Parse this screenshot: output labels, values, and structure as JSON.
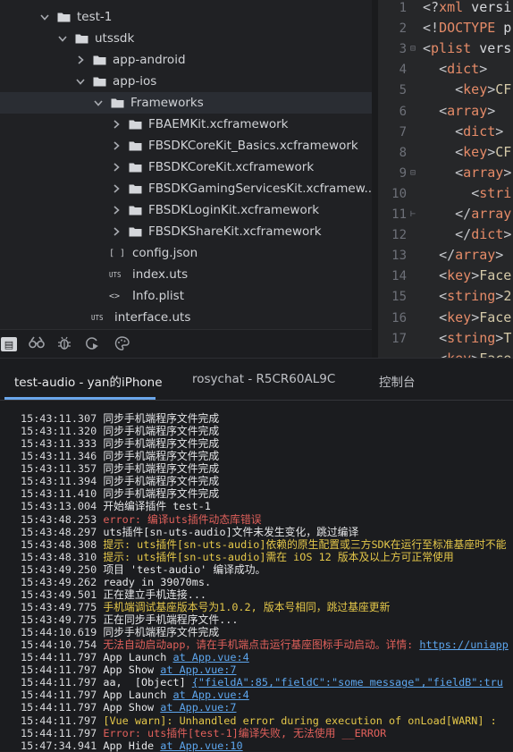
{
  "tree": {
    "items": [
      {
        "label": "test-1",
        "kind": "folder",
        "expanded": true
      },
      {
        "label": "utssdk",
        "kind": "folder",
        "expanded": true
      },
      {
        "label": "app-android",
        "kind": "folder",
        "expanded": false
      },
      {
        "label": "app-ios",
        "kind": "folder",
        "expanded": true
      },
      {
        "label": "Frameworks",
        "kind": "folder",
        "expanded": true
      },
      {
        "label": "FBAEMKit.xcframework",
        "kind": "folder",
        "expanded": false
      },
      {
        "label": "FBSDKCoreKit_Basics.xcframework",
        "kind": "folder",
        "expanded": false
      },
      {
        "label": "FBSDKCoreKit.xcframework",
        "kind": "folder",
        "expanded": false
      },
      {
        "label": "FBSDKGamingServicesKit.xcframew...",
        "kind": "folder",
        "expanded": false
      },
      {
        "label": "FBSDKLoginKit.xcframework",
        "kind": "folder",
        "expanded": false
      },
      {
        "label": "FBSDKShareKit.xcframework",
        "kind": "folder",
        "expanded": false
      },
      {
        "label": "config.json",
        "kind": "file",
        "icon": "[ ]"
      },
      {
        "label": "index.uts",
        "kind": "file",
        "icon": "UTS"
      },
      {
        "label": "Info.plist",
        "kind": "file",
        "icon": "<>"
      },
      {
        "label": "interface.uts",
        "kind": "file",
        "icon": "UTS"
      }
    ],
    "toolbar_icons": [
      "explorer-icon",
      "binoculars-icon",
      "bug-icon",
      "run-icon",
      "palette-icon"
    ]
  },
  "editor": {
    "line_numbers": [
      "1",
      "2",
      "3",
      "4",
      "5",
      "6",
      "7",
      "8",
      "9",
      "10",
      "11",
      "12",
      "13",
      "14",
      "15",
      "16",
      "17"
    ],
    "lines": [
      {
        "t": "<?xml versi"
      },
      {
        "t": "<!DOCTYPE p"
      },
      {
        "t": "<plist vers"
      },
      {
        "t": "  <dict>"
      },
      {
        "t": "    <key>CF"
      },
      {
        "t": "  <array>"
      },
      {
        "t": "    <dict>"
      },
      {
        "t": "    <key>CF"
      },
      {
        "t": "    <array>"
      },
      {
        "t": "      <stri"
      },
      {
        "t": "    </array"
      },
      {
        "t": "    </dict>"
      },
      {
        "t": "  </array>"
      },
      {
        "t": "  <key>Face"
      },
      {
        "t": "  <string>2"
      },
      {
        "t": "  <key>Face"
      },
      {
        "t": "  <string>T"
      },
      {
        "t": "  <key>Face"
      }
    ]
  },
  "console": {
    "tabs": [
      {
        "label": "test-audio - yan的iPhone",
        "active": true
      },
      {
        "label": "rosychat - R5CR60AL9C",
        "active": false
      },
      {
        "label": "控制台",
        "active": false
      }
    ],
    "log": [
      {
        "ts": "15:43:11.307",
        "parts": [
          {
            "text": "同步手机端程序文件完成",
            "style": "msg"
          }
        ]
      },
      {
        "ts": "15:43:11.320",
        "parts": [
          {
            "text": "同步手机端程序文件完成",
            "style": "msg"
          }
        ]
      },
      {
        "ts": "15:43:11.333",
        "parts": [
          {
            "text": "同步手机端程序文件完成",
            "style": "msg"
          }
        ]
      },
      {
        "ts": "15:43:11.346",
        "parts": [
          {
            "text": "同步手机端程序文件完成",
            "style": "msg"
          }
        ]
      },
      {
        "ts": "15:43:11.357",
        "parts": [
          {
            "text": "同步手机端程序文件完成",
            "style": "msg"
          }
        ]
      },
      {
        "ts": "15:43:11.394",
        "parts": [
          {
            "text": "同步手机端程序文件完成",
            "style": "msg"
          }
        ]
      },
      {
        "ts": "15:43:11.410",
        "parts": [
          {
            "text": "同步手机端程序文件完成",
            "style": "msg"
          }
        ]
      },
      {
        "ts": "15:43:13.004",
        "parts": [
          {
            "text": "开始编译插件 test-1",
            "style": "msg"
          }
        ]
      },
      {
        "ts": "15:43:48.253",
        "parts": [
          {
            "text": "error: 编译uts插件动态库错误",
            "style": "error"
          }
        ]
      },
      {
        "ts": "15:43:48.297",
        "parts": [
          {
            "text": "uts插件[sn-uts-audio]文件未发生变化，跳过编译",
            "style": "msg"
          }
        ]
      },
      {
        "ts": "15:43:48.308",
        "parts": [
          {
            "text": "提示: uts插件[sn-uts-audio]依赖的原生配置或三方SDK在运行至标准基座时不能",
            "style": "warn"
          }
        ]
      },
      {
        "ts": "15:43:48.310",
        "parts": [
          {
            "text": "提示: uts插件[sn-uts-audio]需在 iOS 12 版本及以上方可正常使用",
            "style": "warn"
          }
        ]
      },
      {
        "ts": "15:43:49.250",
        "parts": [
          {
            "text": "项目 'test-audio' 编译成功。",
            "style": "msg"
          }
        ]
      },
      {
        "ts": "15:43:49.262",
        "parts": [
          {
            "text": "ready in 39070ms.",
            "style": "msg"
          }
        ]
      },
      {
        "ts": "15:43:49.501",
        "parts": [
          {
            "text": "正在建立手机连接...",
            "style": "msg"
          }
        ]
      },
      {
        "ts": "15:43:49.775",
        "parts": [
          {
            "text": "手机端调试基座版本号为1.0.2, 版本号相同，跳过基座更新",
            "style": "warn"
          }
        ]
      },
      {
        "ts": "15:43:49.775",
        "parts": [
          {
            "text": "正在同步手机端程序文件...",
            "style": "msg"
          }
        ]
      },
      {
        "ts": "15:44:10.619",
        "parts": [
          {
            "text": "同步手机端程序文件完成",
            "style": "msg"
          }
        ]
      },
      {
        "ts": "15:44:10.754",
        "parts": [
          {
            "text": "无法自动启动app，请在手机端点击运行基座图标手动启动。详情: ",
            "style": "error"
          },
          {
            "text": "https://uniapp",
            "style": "link"
          }
        ]
      },
      {
        "ts": "15:44:11.797",
        "parts": [
          {
            "text": "App Launch ",
            "style": "msg"
          },
          {
            "text": "at App.vue:4",
            "style": "link"
          }
        ]
      },
      {
        "ts": "15:44:11.797",
        "parts": [
          {
            "text": "App Show ",
            "style": "msg"
          },
          {
            "text": "at App.vue:7",
            "style": "link"
          }
        ]
      },
      {
        "ts": "15:44:11.797",
        "parts": [
          {
            "text": "aa,  [Object] ",
            "style": "msg"
          },
          {
            "text": "{\"fieldA\":85,\"fieldC\":\"some message\",\"fieldB\":tru",
            "style": "link"
          }
        ]
      },
      {
        "ts": "15:44:11.797",
        "parts": [
          {
            "text": "App Launch ",
            "style": "msg"
          },
          {
            "text": "at App.vue:4",
            "style": "link"
          }
        ]
      },
      {
        "ts": "15:44:11.797",
        "parts": [
          {
            "text": "App Show ",
            "style": "msg"
          },
          {
            "text": "at App.vue:7",
            "style": "link"
          }
        ]
      },
      {
        "ts": "15:44:11.797",
        "parts": [
          {
            "text": "[Vue warn]: Unhandled error during execution of onLoad[WARN] : ",
            "style": "warn"
          }
        ]
      },
      {
        "ts": "15:44:11.797",
        "parts": [
          {
            "text": "Error: uts插件[test-1]编译失败, 无法使用 __ERROR",
            "style": "error"
          }
        ]
      },
      {
        "ts": "15:47:34.941",
        "parts": [
          {
            "text": "App Hide ",
            "style": "msg"
          },
          {
            "text": "at App.vue:10",
            "style": "link"
          }
        ]
      }
    ]
  }
}
